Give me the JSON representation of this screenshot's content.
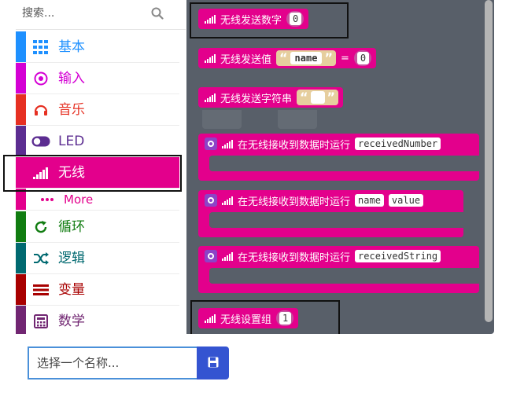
{
  "search": {
    "placeholder": "搜索..."
  },
  "categories": [
    {
      "label": "基本",
      "color": "#1e90ff",
      "icon": "grid-icon"
    },
    {
      "label": "输入",
      "color": "#d400d4",
      "icon": "target-icon"
    },
    {
      "label": "音乐",
      "color": "#e63022",
      "icon": "headphones-icon"
    },
    {
      "label": "LED",
      "color": "#5c2d91",
      "icon": "toggle-icon"
    },
    {
      "label": "无线",
      "color": "#e3008c",
      "icon": "signal-icon"
    },
    {
      "label": "More",
      "color": "#e3008c",
      "icon": "more-dots-icon"
    },
    {
      "label": "循环",
      "color": "#107c10",
      "icon": "loop-icon"
    },
    {
      "label": "逻辑",
      "color": "#006970",
      "icon": "shuffle-icon"
    },
    {
      "label": "变量",
      "color": "#a80000",
      "icon": "list-icon"
    },
    {
      "label": "数学",
      "color": "#712672",
      "icon": "calculator-icon"
    }
  ],
  "blocks": {
    "send_number": {
      "label": "无线发送数字",
      "value": "0"
    },
    "send_value": {
      "label": "无线发送值",
      "name": "name",
      "equals": "=",
      "value": "0"
    },
    "send_string": {
      "label": "无线发送字符串",
      "value": ""
    },
    "on_received_number": {
      "label": "在无线接收到数据时运行",
      "param": "receivedNumber"
    },
    "on_received_value": {
      "label": "在无线接收到数据时运行",
      "param1": "name",
      "param2": "value"
    },
    "on_received_string": {
      "label": "在无线接收到数据时运行",
      "param": "receivedString"
    },
    "set_group": {
      "label": "无线设置组",
      "value": "1"
    }
  },
  "project": {
    "placeholder": "选择一个名称..."
  },
  "colors": {
    "radio": "#e3008c",
    "flyout_bg": "#585f69",
    "save_button": "#3454d1",
    "gear": "#8c43c7"
  }
}
